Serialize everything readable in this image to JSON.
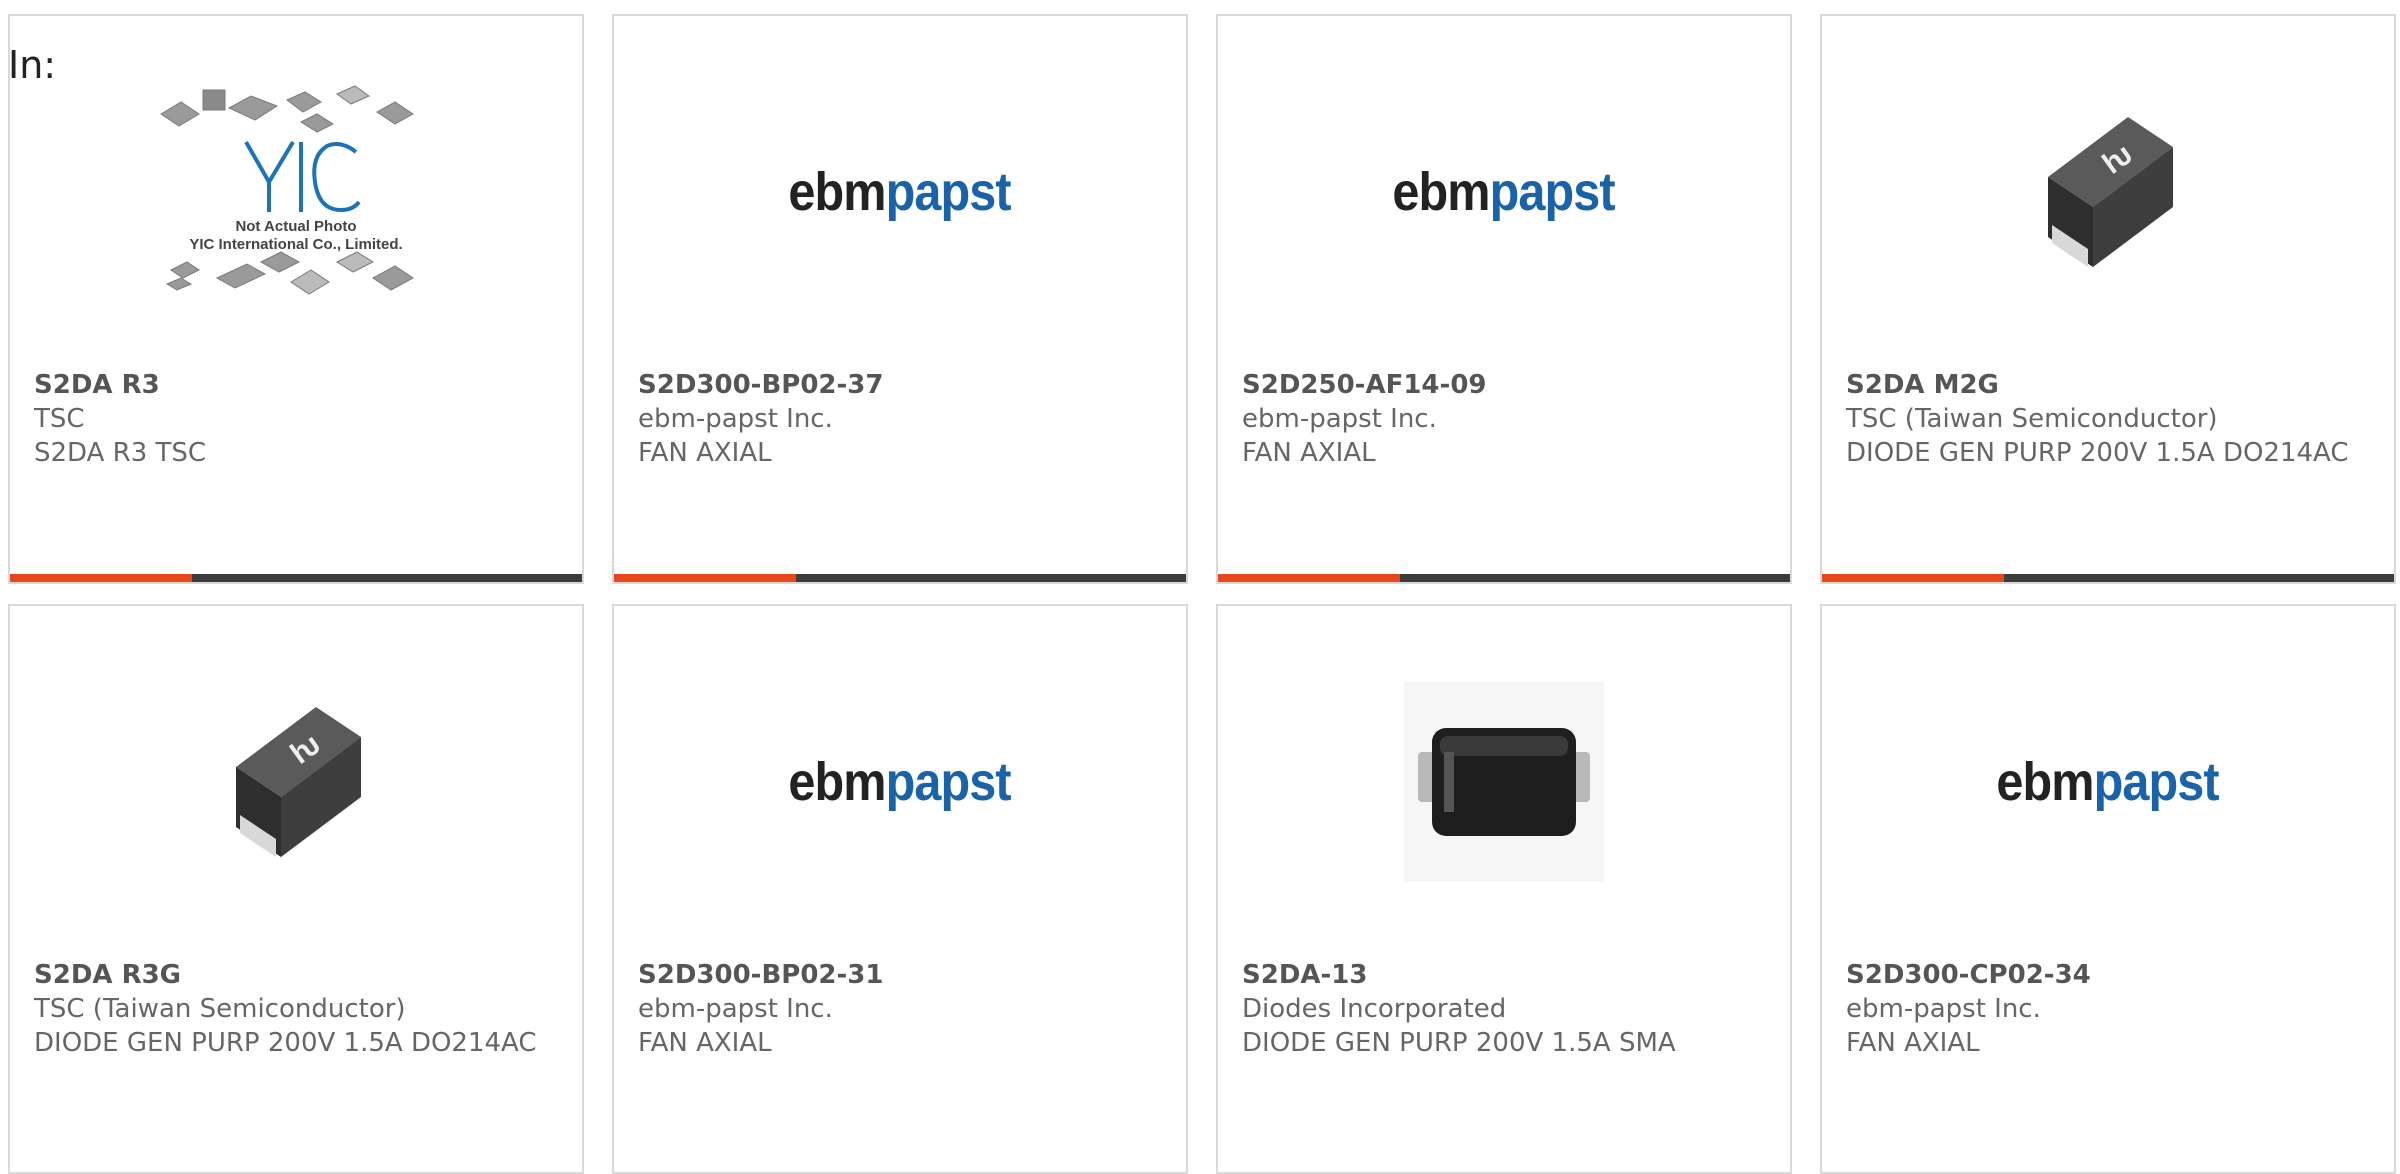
{
  "filter_label": "In:",
  "colors": {
    "accent": "#e8471b",
    "bar": "#3c3c3c",
    "ebm_blue": "#1a63a8",
    "border": "#d9d9d9"
  },
  "products": [
    {
      "image": "yic-placeholder-photo",
      "image_text": [
        "YIC",
        "Not Actual Photo",
        "YIC International Co., Limited."
      ],
      "part_number": "S2DA R3",
      "manufacturer": "TSC",
      "description": "S2DA R3 TSC"
    },
    {
      "image": "ebmpapst-logo",
      "logo_text": [
        "ebm",
        "papst"
      ],
      "part_number": "S2D300-BP02-37",
      "manufacturer": "ebm-papst Inc.",
      "description": "FAN AXIAL"
    },
    {
      "image": "ebmpapst-logo",
      "logo_text": [
        "ebm",
        "papst"
      ],
      "part_number": "S2D250-AF14-09",
      "manufacturer": "ebm-papst Inc.",
      "description": "FAN AXIAL"
    },
    {
      "image": "diode-tsc-photo",
      "part_number": "S2DA M2G",
      "manufacturer": "TSC (Taiwan Semiconductor)",
      "description": "DIODE GEN PURP 200V 1.5A DO214AC"
    },
    {
      "image": "diode-tsc-photo",
      "part_number": "S2DA R3G",
      "manufacturer": "TSC (Taiwan Semiconductor)",
      "description": "DIODE GEN PURP 200V 1.5A DO214AC"
    },
    {
      "image": "ebmpapst-logo",
      "logo_text": [
        "ebm",
        "papst"
      ],
      "part_number": "S2D300-BP02-31",
      "manufacturer": "ebm-papst Inc.",
      "description": "FAN AXIAL"
    },
    {
      "image": "diode-sma-photo",
      "part_number": "S2DA-13",
      "manufacturer": "Diodes Incorporated",
      "description": "DIODE GEN PURP 200V 1.5A SMA"
    },
    {
      "image": "ebmpapst-logo",
      "logo_text": [
        "ebm",
        "papst"
      ],
      "part_number": "S2D300-CP02-34",
      "manufacturer": "ebm-papst Inc.",
      "description": "FAN AXIAL"
    }
  ]
}
